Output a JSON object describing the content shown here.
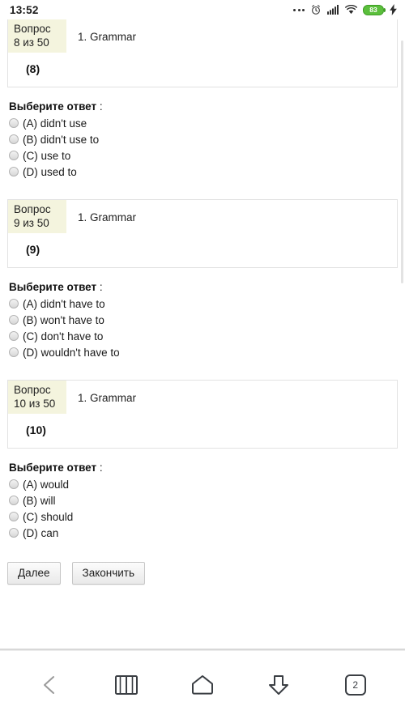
{
  "status_bar": {
    "time": "13:52",
    "icons": [
      "more-dots-icon",
      "alarm-clock-icon",
      "signal-bars-icon",
      "wifi-icon",
      "battery-icon",
      "charging-bolt-icon"
    ],
    "battery_level": "83"
  },
  "quiz": {
    "answers_label": "Выберите ответ",
    "answers_colon": " :",
    "questions": [
      {
        "counter": "Вопрос\n8 из 50",
        "section": "1. Grammar",
        "body": "(8)",
        "options": [
          {
            "label": "(A) didn't use",
            "selected": false
          },
          {
            "label": "(B) didn't use to",
            "selected": false
          },
          {
            "label": "(C) use to",
            "selected": false
          },
          {
            "label": "(D) used to",
            "selected": false
          }
        ]
      },
      {
        "counter": "Вопрос\n9 из 50",
        "section": "1. Grammar",
        "body": "(9)",
        "options": [
          {
            "label": "(A) didn't have to",
            "selected": false
          },
          {
            "label": "(B) won't have to",
            "selected": false
          },
          {
            "label": "(C) don't have to",
            "selected": false
          },
          {
            "label": "(D) wouldn't have to",
            "selected": false
          }
        ]
      },
      {
        "counter": "Вопрос\n10 из 50",
        "section": "1. Grammar",
        "body": "(10)",
        "options": [
          {
            "label": "(A) would",
            "selected": false
          },
          {
            "label": "(B) will",
            "selected": false
          },
          {
            "label": "(C) should",
            "selected": false
          },
          {
            "label": "(D) can",
            "selected": false
          }
        ]
      }
    ],
    "buttons": {
      "next": "Далее",
      "finish": "Закончить"
    }
  },
  "browser_nav": {
    "items": [
      {
        "name": "back-icon",
        "label": ""
      },
      {
        "name": "bookmarks-icon",
        "label": ""
      },
      {
        "name": "home-icon",
        "label": ""
      },
      {
        "name": "downloads-icon",
        "label": ""
      },
      {
        "name": "tabs-icon",
        "label": "2"
      }
    ],
    "tab_count": "2"
  },
  "colors": {
    "question_badge_bg": "#f4f4de",
    "battery_green": "#5bbf3c",
    "box_border": "#e2e2e2"
  }
}
